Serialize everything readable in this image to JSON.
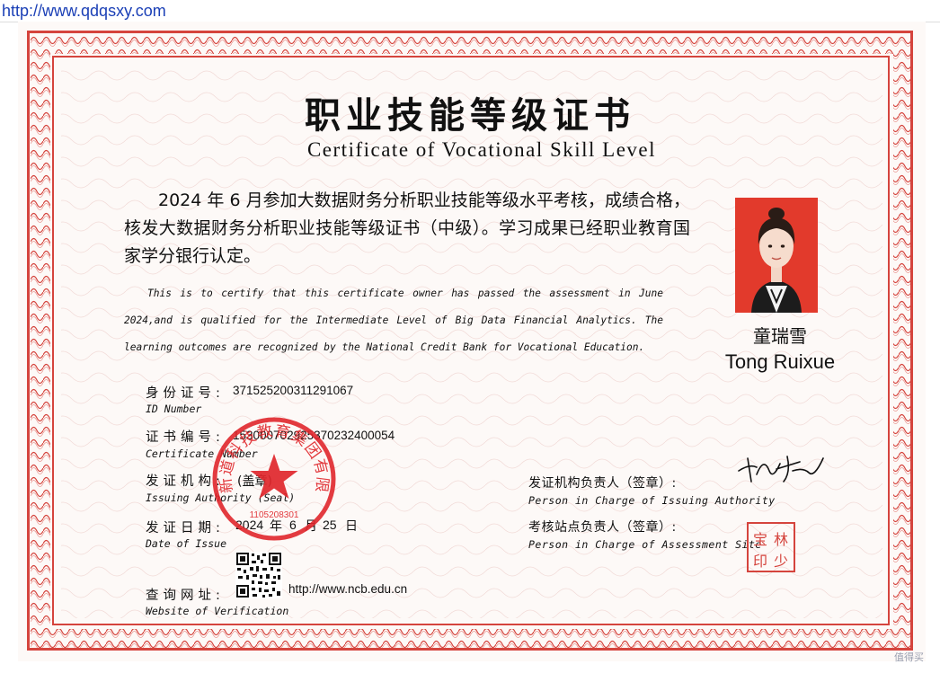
{
  "browser": {
    "url": "http://www.qdqsxy.com"
  },
  "certificate": {
    "title_cn": "职业技能等级证书",
    "title_en": "Certificate of Vocational Skill Level",
    "statement_cn": "2024 年 6 月参加大数据财务分析职业技能等级水平考核，成绩合格，核发大数据财务分析职业技能等级证书（中级）。学习成果已经职业教育国家学分银行认定。",
    "statement_en": "This is to certify that this certificate owner has passed the assessment in June 2024,and is qualified for the Intermediate Level of Big Data Financial Analytics. The learning outcomes are recognized by the National Credit Bank for Vocational Education.",
    "holder": {
      "name_cn": "童瑞雪",
      "name_en": "Tong Ruixue"
    },
    "fields": {
      "id_number": {
        "label_cn": "身份证号:",
        "label_en": "ID Number",
        "value": "371525200311291067"
      },
      "certificate_number": {
        "label_cn": "证书编号:",
        "label_en": "Certificate Number",
        "value": "153000702925370232400054"
      },
      "issuing_authority": {
        "label_cn": "发证机构:",
        "label_en": "Issuing Authority (Seal)",
        "value": "(盖章)"
      },
      "date_of_issue": {
        "label_cn": "发证日期:",
        "label_en": "Date of Issue",
        "year": "2024",
        "year_unit": "年",
        "month": "6",
        "month_unit": "月",
        "day": "25",
        "day_unit": "日"
      },
      "website": {
        "label_cn": "查询网址:",
        "label_en": "Website of Verification",
        "value": "http://www.ncb.edu.cn"
      }
    },
    "responsible": {
      "authority_cn": "发证机构负责人（签章）:",
      "authority_en": "Person in Charge of Issuing Authority",
      "site_cn": "考核站点负责人（签章）:",
      "site_en": "Person in Charge of Assessment Site"
    },
    "seal": {
      "text": "北京新道科技教育集团有限公司",
      "code": "1105208301"
    },
    "site_stamp": {
      "chars": [
        "宝",
        "林",
        "印",
        "少"
      ]
    },
    "colors": {
      "accent": "#d5443d",
      "seal": "#e0262b",
      "photo_bg": "#e23a2c"
    }
  },
  "watermark": "值得买"
}
